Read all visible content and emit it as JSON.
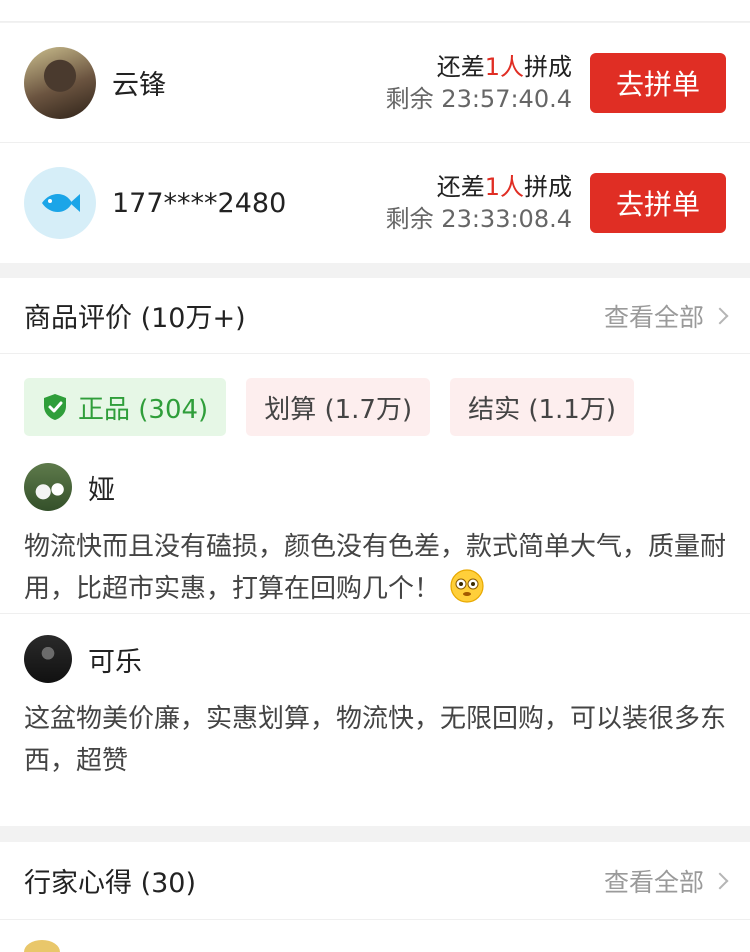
{
  "group_buy": {
    "items": [
      {
        "name": "云锋",
        "prefix": "还差",
        "count": "1人",
        "suffix": "拼成",
        "remaining": "剩余 23:57:40.4",
        "button": "去拼单"
      },
      {
        "name": "177****2480",
        "prefix": "还差",
        "count": "1人",
        "suffix": "拼成",
        "remaining": "剩余 23:33:08.4",
        "button": "去拼单"
      }
    ]
  },
  "reviews": {
    "title": "商品评价 (10万+)",
    "see_all": "查看全部",
    "tags": [
      {
        "label": "正品 (304)"
      },
      {
        "label": "划算 (1.7万)"
      },
      {
        "label": "结实 (1.1万)"
      }
    ],
    "items": [
      {
        "user": "娅",
        "text": "物流快而且没有磕损，颜色没有色差，款式简单大气，质量耐用，比超市实惠，打算在回购几个！"
      },
      {
        "user": "可乐",
        "text": "这盆物美价廉，实惠划算，物流快，无限回购，可以装很多东西，超赞"
      }
    ]
  },
  "experts": {
    "title": "行家心得 (30)",
    "see_all": "查看全部"
  },
  "colors": {
    "accent_red": "#e02e24",
    "tag_green": "#2f9e3a",
    "tag_green_bg": "#e6f7e6",
    "tag_pink_bg": "#fdeeee"
  }
}
